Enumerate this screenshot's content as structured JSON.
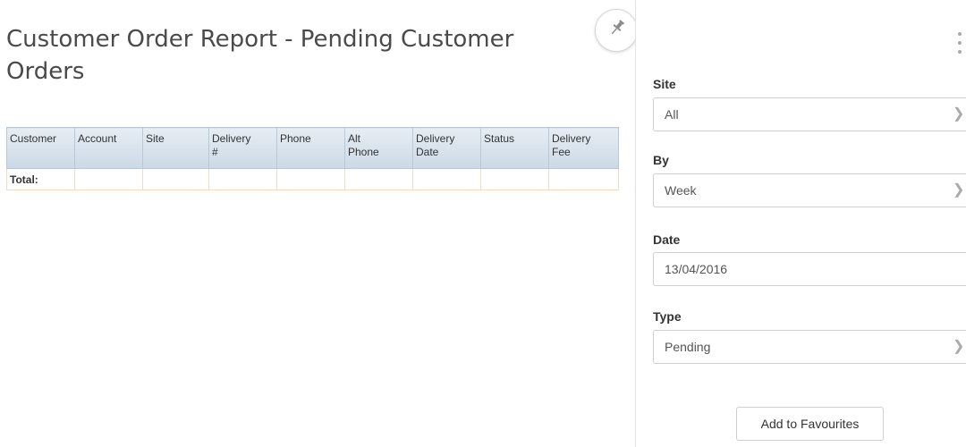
{
  "report": {
    "title": "Customer Order Report - Pending Customer Orders",
    "columns": [
      {
        "line1": "Customer",
        "line2": ""
      },
      {
        "line1": "Account",
        "line2": ""
      },
      {
        "line1": "Site",
        "line2": ""
      },
      {
        "line1": "Delivery",
        "line2": "#"
      },
      {
        "line1": "Phone",
        "line2": ""
      },
      {
        "line1": "Alt",
        "line2": "Phone"
      },
      {
        "line1": "Delivery",
        "line2": "Date"
      },
      {
        "line1": "Status",
        "line2": ""
      },
      {
        "line1": "Delivery",
        "line2": "Fee"
      }
    ],
    "total_label": "Total:"
  },
  "toolbar": {
    "pin_icon": "pin-icon",
    "menu_icon": "kebab-menu-icon"
  },
  "filters": {
    "site": {
      "label": "Site",
      "value": "All"
    },
    "by": {
      "label": "By",
      "value": "Week"
    },
    "date": {
      "label": "Date",
      "value": "13/04/2016"
    },
    "type": {
      "label": "Type",
      "value": "Pending"
    }
  },
  "actions": {
    "add_favourites_label": "Add to Favourites"
  },
  "colors": {
    "header_bg": "#ccd9e6",
    "header_border": "#b9c8d6",
    "row_border": "#f0dcc8",
    "title_text": "#4a4a4a"
  }
}
